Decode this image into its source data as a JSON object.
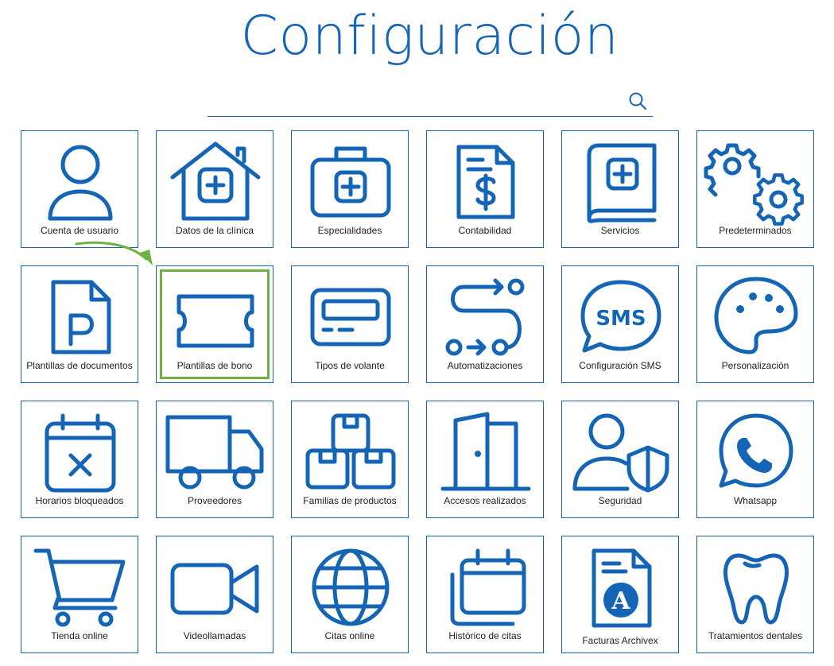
{
  "page": {
    "title": "Configuración"
  },
  "search": {
    "placeholder": "",
    "value": "",
    "icon": "search-icon"
  },
  "colors": {
    "accent": "#1565b7",
    "highlight": "#6db33f"
  },
  "tiles": [
    {
      "label": "Cuenta de usuario",
      "icon": "user-icon"
    },
    {
      "label": "Datos de la clínica",
      "icon": "clinic-house-icon"
    },
    {
      "label": "Especialidades",
      "icon": "medical-kit-icon"
    },
    {
      "label": "Contabilidad",
      "icon": "invoice-dollar-icon"
    },
    {
      "label": "Servicios",
      "icon": "medical-book-icon"
    },
    {
      "label": "Predeterminados",
      "icon": "gears-icon"
    },
    {
      "label": "Plantillas de documentos",
      "icon": "document-p-icon"
    },
    {
      "label": "Plantillas de bono",
      "icon": "ticket-icon"
    },
    {
      "label": "Tipos de volante",
      "icon": "pager-icon"
    },
    {
      "label": "Automatizaciones",
      "icon": "workflow-icon"
    },
    {
      "label": "Configuración SMS",
      "icon": "sms-bubble-icon"
    },
    {
      "label": "Personalización",
      "icon": "palette-icon"
    },
    {
      "label": "Horarios bloqueados",
      "icon": "calendar-x-icon"
    },
    {
      "label": "Proveedores",
      "icon": "truck-icon"
    },
    {
      "label": "Familias de productos",
      "icon": "boxes-icon"
    },
    {
      "label": "Accesos realizados",
      "icon": "door-icon"
    },
    {
      "label": "Seguridad",
      "icon": "user-shield-icon"
    },
    {
      "label": "Whatsapp",
      "icon": "whatsapp-icon"
    },
    {
      "label": "Tienda online",
      "icon": "cart-icon"
    },
    {
      "label": "Videollamadas",
      "icon": "video-camera-icon"
    },
    {
      "label": "Citas online",
      "icon": "globe-icon"
    },
    {
      "label": "Histórico de citas",
      "icon": "calendar-stack-icon"
    },
    {
      "label": "Facturas Archivex",
      "icon": "archivex-invoice-icon"
    },
    {
      "label": "Tratamientos dentales",
      "icon": "tooth-icon"
    }
  ]
}
